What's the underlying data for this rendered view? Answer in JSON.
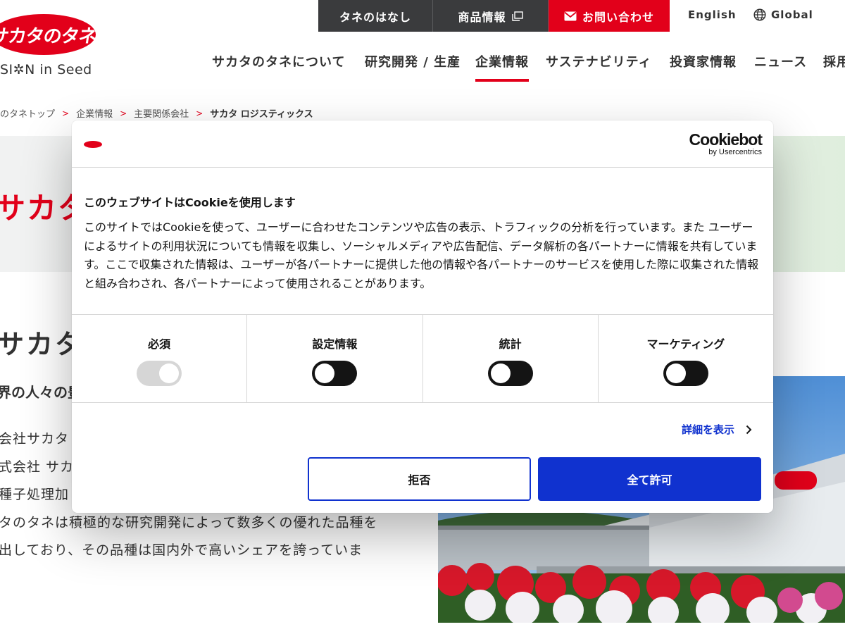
{
  "header": {
    "logo_text": "サカタのタネ",
    "logo_tagline": "SI✲N in Seed",
    "top_links": [
      {
        "label": "タネのはなし"
      },
      {
        "label": "商品情報"
      },
      {
        "label": "お問い合わせ"
      }
    ],
    "lang_english": "English",
    "lang_global": "Global"
  },
  "nav": {
    "items": [
      {
        "label": "サカタのタネについて"
      },
      {
        "label": "研究開発 / 生産"
      },
      {
        "label": "企業情報",
        "active": true
      },
      {
        "label": "サステナビリティ"
      },
      {
        "label": "投資家情報"
      },
      {
        "label": "ニュース"
      },
      {
        "label": "採用"
      }
    ]
  },
  "breadcrumb": {
    "items": [
      "のタネトップ",
      "企業情報",
      "主要関係会社",
      "サカタ ロジスティックス"
    ],
    "separator": ">"
  },
  "hero": {
    "title": "サカタ"
  },
  "page": {
    "heading": "サカタ ロ",
    "lead": "界の人々の豊",
    "paragraph_lines": [
      "会社サカタ",
      "式会社 サカ",
      "種子処理加",
      "タのタネは積極的な研究開発によって数多くの優れた品種を",
      "出しており、その品種は国内外で高いシェアを誇っていま"
    ]
  },
  "cookie_dialog": {
    "powered_by": "Cookiebot",
    "powered_by_sub": "by Usercentrics",
    "title": "このウェブサイトはCookieを使用します",
    "body": "このサイトではCookieを使って、ユーザーに合わせたコンテンツや広告の表示、トラフィックの分析を行っています。また ユーザーによるサイトの利用状況についても情報を収集し、ソーシャルメディアや広告配信、データ解析の各パートナーに情報を共有しています。ここで収集された情報は、ユーザーが各パートナーに提供した他の情報や各パートナーのサービスを使用した際に収集された情報と組み合わされ、各パートナーによって使用されることがあります。",
    "categories": [
      {
        "label": "必須",
        "enabled": true,
        "locked": true
      },
      {
        "label": "設定情報",
        "enabled": false,
        "locked": false
      },
      {
        "label": "統計",
        "enabled": false,
        "locked": false
      },
      {
        "label": "マーケティング",
        "enabled": false,
        "locked": false
      }
    ],
    "details_link": "詳細を表示",
    "deny_label": "拒否",
    "allow_label": "全て許可"
  },
  "colors": {
    "brand_red": "#e2001a",
    "topbar_dark": "#3a3b3d",
    "cookiebot_blue": "#1032cf"
  }
}
